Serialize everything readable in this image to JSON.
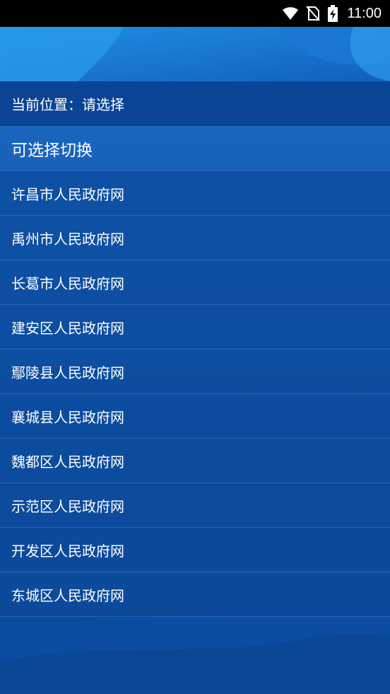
{
  "status_bar": {
    "time": "11:00",
    "icons": [
      "wifi-icon",
      "no-sim-icon",
      "battery-charging-icon"
    ]
  },
  "location": {
    "label": "当前位置：请选择"
  },
  "switch_header": {
    "label": "可选择切换"
  },
  "gov_sites": [
    {
      "label": "许昌市人民政府网"
    },
    {
      "label": "禹州市人民政府网"
    },
    {
      "label": "长葛市人民政府网"
    },
    {
      "label": "建安区人民政府网"
    },
    {
      "label": "鄢陵县人民政府网"
    },
    {
      "label": "襄城县人民政府网"
    },
    {
      "label": "魏都区人民政府网"
    },
    {
      "label": "示范区人民政府网"
    },
    {
      "label": "开发区人民政府网"
    },
    {
      "label": "东城区人民政府网"
    }
  ],
  "colors": {
    "background": "#0d55a8",
    "header_light": "#2a8ee0",
    "status_bar": "#000000"
  }
}
